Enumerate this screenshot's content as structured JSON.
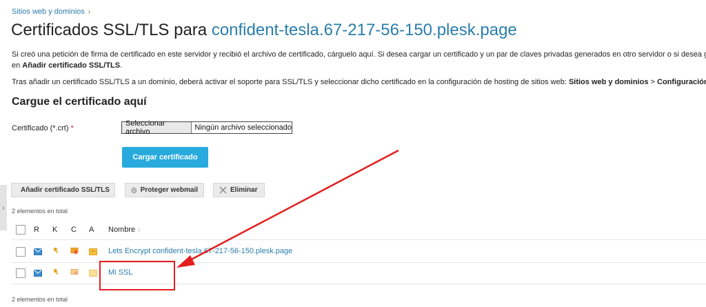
{
  "breadcrumb": {
    "item": "Sitios web y dominios",
    "separator": "›"
  },
  "title": {
    "prefix": "Certificados SSL/TLS para ",
    "domain": "confident-tesla.67-217-56-150.plesk.page"
  },
  "intro": {
    "p1_line1": "Si creó una petición de firma de certificado en este servidor y recibió el archivo de certificado, cárguelo aquí. Si desea cargar un certificado y un par de claves privadas generados en otro servidor o si desea gen",
    "p1_line2_pre": "en ",
    "p1_line2_bold": "Añadir certificado SSL/TLS",
    "p1_line2_post": ".",
    "p2_pre": "Tras añadir un certificado SSL/TLS a un dominio, deberá activar el soporte para SSL/TLS y seleccionar dicho certificado en la configuración de hosting de sitios web: ",
    "p2_bold1": "Sitios web y dominios",
    "p2_mid": " > ",
    "p2_bold2": "Configuración de ho"
  },
  "upload": {
    "section_title": "Cargue el certificado aquí",
    "field_label": "Certificado (*.crt)",
    "required_mark": "*",
    "file_button": "Seleccionar archivo",
    "file_status": "Ningún archivo seleccionado",
    "submit": "Cargar certificado"
  },
  "toolbar": {
    "add": "Añadir certificado SSL/TLS",
    "protect": "Proteger webmail",
    "delete": "Eliminar"
  },
  "list": {
    "count_top": "2 elementos en total",
    "count_bottom": "2 elementos en total",
    "headers": {
      "r": "R",
      "k": "K",
      "c": "C",
      "a": "A",
      "name": "Nombre",
      "sort": "↑"
    },
    "rows": [
      {
        "name": "Lets Encrypt confident-tesla.67-217-56-150.plesk.page"
      },
      {
        "name": "Mi SSL"
      }
    ]
  },
  "side_toggle": "‹",
  "colors": {
    "accent": "#28aade",
    "link": "#2a7dab",
    "annotation": "#e31d1d"
  }
}
